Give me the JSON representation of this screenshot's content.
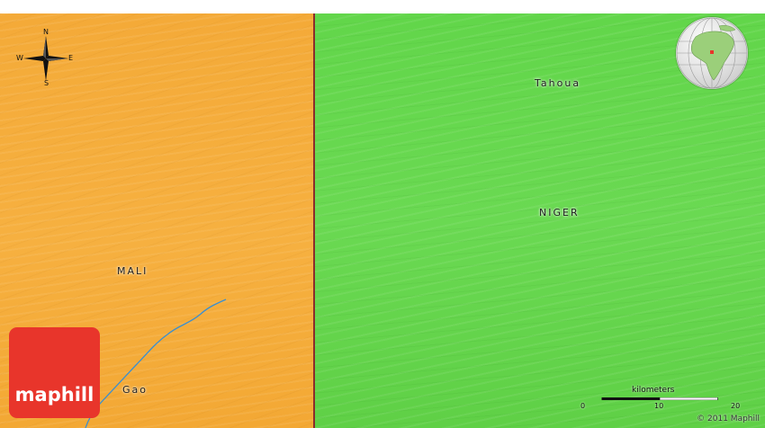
{
  "map": {
    "colors": {
      "mali_fill": "#f4aa38",
      "niger_fill": "#62d64a",
      "border": "#8b2c2c",
      "river": "#3a8fd0",
      "logo_bg": "#e8352b"
    },
    "labels": {
      "mali": "MALI",
      "niger": "NIGER",
      "tahoua": "Tahoua",
      "gao": "Gao"
    },
    "compass": {
      "n": "N",
      "s": "S",
      "e": "E",
      "w": "W",
      "icon": "compass-rose-icon"
    },
    "globe": {
      "icon": "globe-locator-icon"
    },
    "logo": {
      "text": "maphill"
    },
    "scale": {
      "title": "kilometers",
      "ticks": [
        "0",
        "10",
        "20"
      ]
    },
    "copyright": "© 2011 Maphill"
  }
}
